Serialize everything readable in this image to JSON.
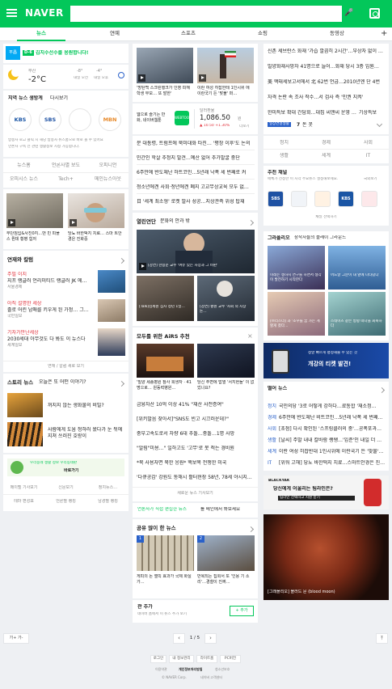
{
  "header": {
    "logo": "NAVER"
  },
  "tabs": [
    "뉴스",
    "연예",
    "스포츠",
    "쇼핑",
    "동영상"
  ],
  "left": {
    "banner_badge": "D-6",
    "banner_text": "김지수선수를 응원합니다!",
    "weather": {
      "location": "부산",
      "temp": "-2°C",
      "tomorrow_am": "내일 오전",
      "tomorrow_pm": "내일 오후",
      "am_temp": "-8°",
      "pm_temp": "-4°"
    },
    "news_setting": "지역 뉴스 생방게",
    "news_setting_more": "다시보기",
    "broadcasters": [
      "KBS",
      "SBS",
      "",
      "MBN"
    ],
    "notice1": "방송사 로고 클릭 시 해당 방송사 뉴스홈으로 바로 볼 수 있어요",
    "notice2": "언론사 구독 전 관련 생활정보 시청 가능합니다.",
    "cats": [
      "뉴스홈",
      "언론사별 보도",
      "오피니언",
      "오피시스 뉴스",
      "Tech+",
      "메인뉴스아웃"
    ],
    "videos": [
      {
        "caption": "무단침입&사진0지…떤 빈 피폴스 뭔데 황병 힘저",
        "img": "ph-room"
      },
      {
        "caption": "당뇨 바한떡지 치료… 스마 트안경은 진화중",
        "img": "ph-glasses"
      }
    ],
    "column_title": "연재와 칼럼",
    "columns": [
      {
        "tag": "주필 이지",
        "title": "지프 랭글러 언리미티드 랭글러 JK 에…",
        "src": "서울경제"
      },
      {
        "tag": "아직 설명한 세상",
        "title": "졸로 어린 남매를 키우게 된 가정… 그…",
        "src": "국민일보"
      },
      {
        "tag": "기자가만난세상",
        "title": "2030세대 아무것도 다 봐도 이 뉴스다",
        "src": "세계일보"
      }
    ],
    "column_more": "연재 / 칼럼 새로 보기",
    "story_title": "스토리 뉴스",
    "story_sub": "오늘은 또 어떤 이야기?",
    "stories": [
      {
        "title": "꺼지지 않는 생화불의 비밀?"
      },
      {
        "title": "사람에게 도움 청하러 왔다가 눈 뒤에 지쳐 쓰러진 호랑이"
      }
    ],
    "ad_text": "우리동네 생활 정보 우리동네판",
    "ad_sub": "바로가기",
    "bottom_links": [
      "메이벨 기사보기",
      "신문보기",
      "정치뉴스…",
      "테마 편성표",
      "언론별 랭킹",
      "남경별 랭킹"
    ]
  },
  "middle": {
    "top_news": [
      {
        "caption": "'방탄백 스크린행크가 인영 피해 학생 부모… 또 발한'"
      },
      {
        "caption": "이란 여성 히잡한테 1인시위 에 이란국기 든 '맞불' 퍼…"
      }
    ],
    "webtoon": "웹으로 즐기는 만화, 네이버웹툰",
    "exchange": {
      "label": "달러환율",
      "value": "1,086.50",
      "unit": "원",
      "change": "▲ 10.50 +1.30%",
      "more": "더보기"
    },
    "headlines": [
      "문 대통령, 트럼프에 북미대화 타진… '평창 이후'도 논의",
      "민간인 학살 추정지 발견…예산 없어 추가발굴 중단",
      "6주만에 반도체난 하트코인…5년래 낙폭 세 번째로 커",
      "청소년에겐 사회·청년에겐 폐지 고교무상교육 모두 없…",
      "日 '세계 최소형' 로켓 발사 성공…지상관측 위성 탑재"
    ],
    "culture_title": "열린연단",
    "culture_sub": "문화의 안과 밖",
    "culture_main": "[강연] 한용운 교수 '여유 있는 사상과 그 비판'",
    "culture_subs": [
      "[Talk]김제원 심사 정년 1일…",
      "[강연] 황원 교수 '사회 의 시장 논…"
    ],
    "airs_title": "모두를 위한 AiRS 추천",
    "airs_pics": [
      "'밀양 세종병원 참사 희생자 · 41명으로… 원동력병원…",
      "당신 주변에 밥열 '서지현들' 이 없었나요?"
    ],
    "airs_list": [
      "금융자산 10억 이상 41% \"재산 사전증여\"",
      "[위키발음 찾아서]\"SNS도 빈고 시끄러운데?\"",
      "중부고속도로서 차량 6대 추돌…중돌…1명 사망",
      "\"알림\"미용…\" 일하고도 '고무'로 못 적는 경비원",
      "*북 사용자면 북한 응원* 핵보복 전쟁한 미국",
      "'다큐공감' 강원도 동해시 활터현장 58년, 78세 야시지…"
    ],
    "airs_more": "새로운 뉴스 기사보기",
    "tip": "언론사가 직접 편집한 뉴스",
    "tip_tail": "를 메인에서 봐보세요",
    "popular_title": "공유 많이 한 뉴스",
    "popular": [
      {
        "rank": "1",
        "caption": "게피의 돈 엘빅 효과가 국제 화실 가…"
      },
      {
        "rank": "2",
        "caption": "반복되는 집회서 또 '인용 기 소리'…경찰이 진짜…"
      }
    ],
    "fav_title": "관 추가",
    "fav_sub": "네이버 홈에서 이 뉴스 추가 보기",
    "fav_btn": "+ 추가",
    "pager": "1 / 5"
  },
  "right": {
    "realtime": [
      {
        "text": "신촌 세브란스 화재 '가습 깔끔히 2시간'…부상자 없이 진화"
      },
      {
        "text": "밀양화재사망자 41명으로 늘어…화재 당시 3층 입원…"
      },
      {
        "text": "美 핵태세보고서에서 北 62번 언급…2010년엔 단 4번"
      },
      {
        "text": "자격 논란 속 조사 착수…서 검사 측 '인권 지켜'"
      },
      {
        "text": "한미특보 확대 간담회…대집 씨앤씨 운영 13조",
        "tail": "기상특보"
      }
    ],
    "rt_badge": "일상연결생활",
    "rt_count": "7",
    "rt_label": "돈 꼿",
    "cats": [
      "정치",
      "경제",
      "사회",
      "생활",
      "세계",
      "IT"
    ],
    "press_title": "추천 채널",
    "press_sub": "매체가 선정한 이 시각 주요뉴스 설정해보세요.",
    "press_sub2": "국외보기",
    "press_logos": [
      "SBS",
      "",
      "",
      "KBS"
    ],
    "press_more": "채널 선택하기",
    "gr_title": "그라폴리오",
    "gr_sub": "창작자들의 플레이 그라운드",
    "gr": [
      {
        "caption": "미래는 생하지 연구를 하면서 생각이 발전하기 시작한다"
      },
      {
        "caption": "어느날 그분이 내 앞에 나타났다"
      },
      {
        "caption": "[브리스너] 과 '조우를 꿈 가는 게 할게 찼다…"
      },
      {
        "caption": "스테이츠 같은 방향 떠나을 회복하다"
      }
    ],
    "ad_title": "정말 빠르게 평정해줄 수 있는 것",
    "ad_sub": "개강의 티켓 발견!",
    "tech_title": "떨어 뉴스",
    "tech_more": "",
    "tech_list": [
      {
        "tag": "정치",
        "text": "국민의당 '3로 어떻게 강하다…료통합 '재소정…"
      },
      {
        "tag": "경제",
        "text": "6주만에 반도체난 비트코인…5년래 낙폭 세 번째…"
      },
      {
        "tag": "사회",
        "text": "[초점] 다시 확인된 '스프링클러의 중'…공폭포과…"
      },
      {
        "tag": "생활",
        "text": "[날씨] 주말 내내 칼바람 쌩쌩…'입춘'인 내일 더 추워"
      },
      {
        "tag": "세계",
        "text": "이란 여성 히잡반대 1인시위에 이란국기 든 '맞불'…"
      },
      {
        "tag": "IT",
        "text": "[위워 고해] 당뇨 바한떡지 치료…스마트안경은 진화중"
      }
    ],
    "bd_text": "당신에게 어울리는 팀라인은?",
    "bd_sub": "팀라인 선택하고 지원 받기",
    "moon_caption": "[그래폴리오] 블러드 문 (blood moon)"
  },
  "footer": {
    "links": [
      "로그인",
      "내 정보관리",
      "라이트홈",
      "PC버전"
    ],
    "links2": [
      "이용약관",
      "개인정보처리방침",
      "청소년보호",
      "청소년정책"
    ],
    "copy": "© NAVER Corp.",
    "copy2": "네이버 고객센터",
    "font": "가+ 가-"
  },
  "colors": {
    "green": "#03c75a",
    "bg": "#eef0f3"
  }
}
